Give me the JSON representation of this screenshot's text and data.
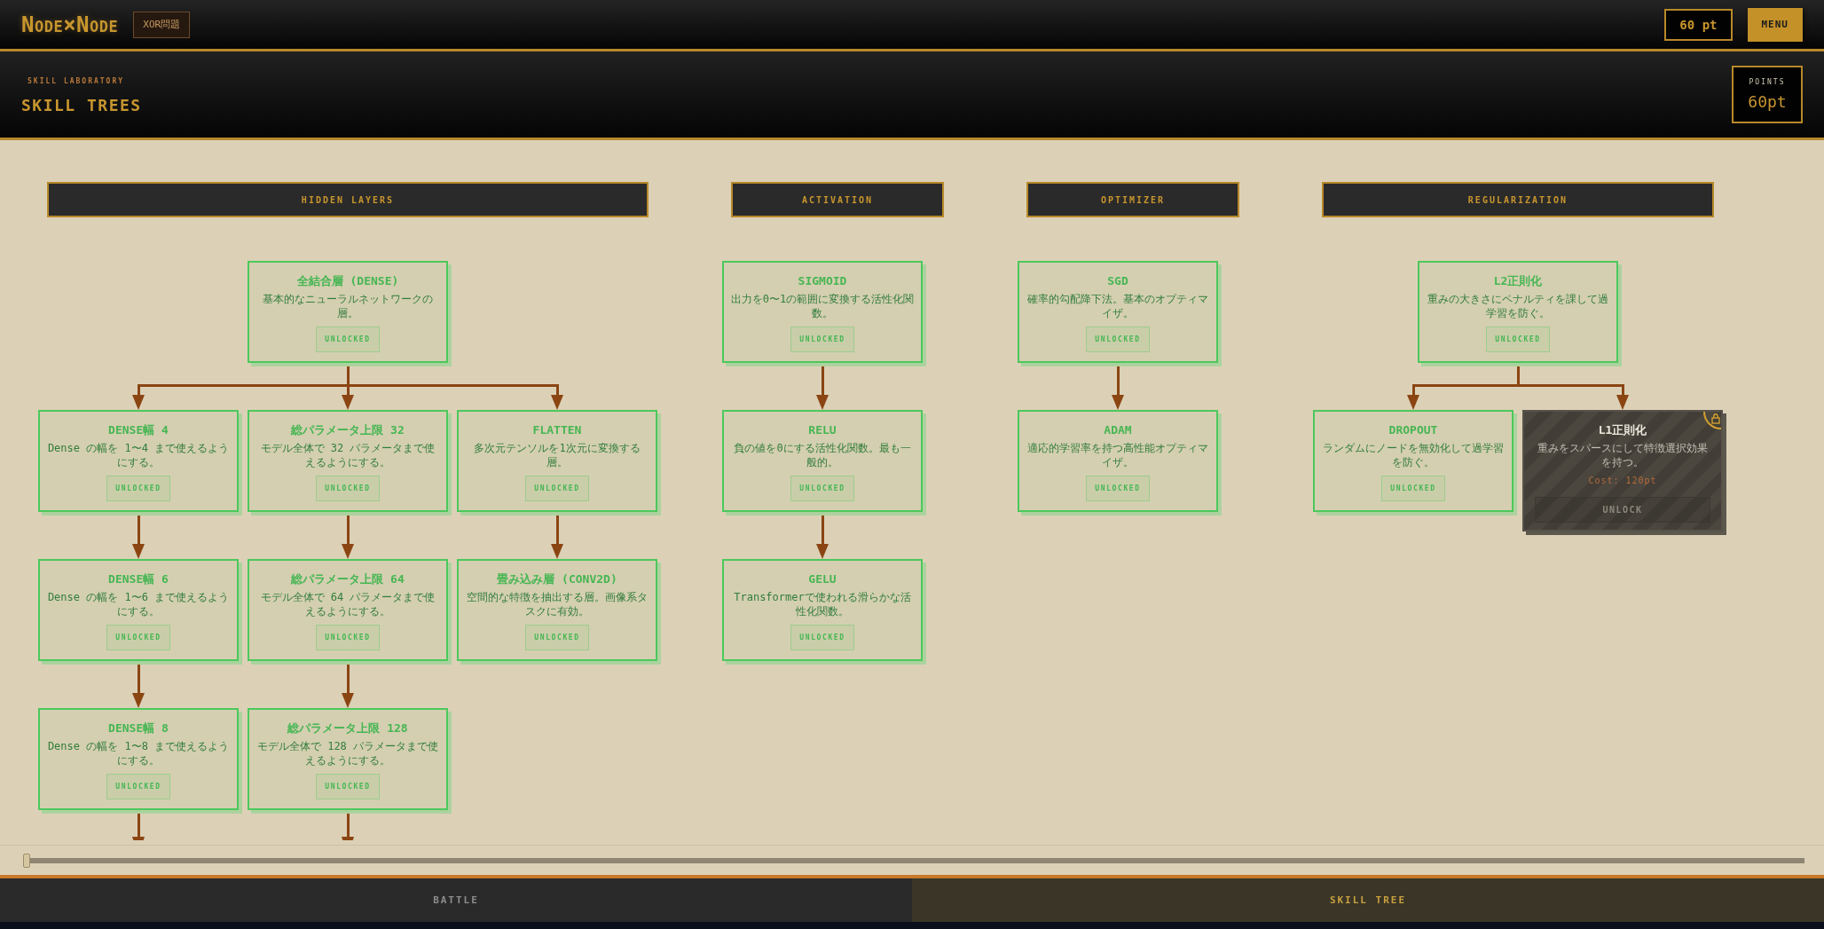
{
  "top_bar": {
    "logo": "Node×Node",
    "problem_badge": "XOR問題",
    "points": "60 pt",
    "menu_button": "MENU"
  },
  "header": {
    "eyebrow": "SKILL LABORATORY",
    "title": "SKILL TREES",
    "points_label": "POINTS",
    "points_value": "60pt"
  },
  "categories": [
    {
      "title": "HIDDEN LAYERS",
      "tree": {
        "kind": "unlocked",
        "title": "全結合層 (DENSE)",
        "description": "基本的なニューラルネットワークの層。",
        "badge": "UNLOCKED",
        "children": [
          {
            "kind": "unlocked",
            "title": "DENSE幅 4",
            "description": "Dense の幅を 1〜4 まで使えるようにする。",
            "badge": "UNLOCKED",
            "children": [
              {
                "kind": "unlocked",
                "title": "DENSE幅 6",
                "description": "Dense の幅を 1〜6 まで使えるようにする。",
                "badge": "UNLOCKED",
                "children": [
                  {
                    "kind": "unlocked",
                    "title": "DENSE幅 8",
                    "description": "Dense の幅を 1〜8 まで使えるようにする。",
                    "badge": "UNLOCKED",
                    "continues": true
                  }
                ]
              }
            ]
          },
          {
            "kind": "unlocked",
            "title": "総パラメータ上限 32",
            "description": "モデル全体で 32 パラメータまで使えるようにする。",
            "badge": "UNLOCKED",
            "children": [
              {
                "kind": "unlocked",
                "title": "総パラメータ上限 64",
                "description": "モデル全体で 64 パラメータまで使えるようにする。",
                "badge": "UNLOCKED",
                "children": [
                  {
                    "kind": "unlocked",
                    "title": "総パラメータ上限 128",
                    "description": "モデル全体で 128 パラメータまで使えるようにする。",
                    "badge": "UNLOCKED",
                    "continues": true
                  }
                ]
              }
            ]
          },
          {
            "kind": "unlocked",
            "title": "FLATTEN",
            "description": "多次元テンソルを1次元に変換する層。",
            "badge": "UNLOCKED",
            "children": [
              {
                "kind": "unlocked",
                "title": "畳み込み層 (CONV2D)",
                "description": "空間的な特徴を抽出する層。画像系タスクに有効。",
                "badge": "UNLOCKED",
                "continues": false
              }
            ]
          }
        ]
      }
    },
    {
      "title": "ACTIVATION",
      "tree": {
        "kind": "unlocked",
        "title": "SIGMOID",
        "description": "出力を0〜1の範囲に変換する活性化関数。",
        "badge": "UNLOCKED",
        "children": [
          {
            "kind": "unlocked",
            "title": "RELU",
            "description": "負の値を0にする活性化関数。最も一般的。",
            "badge": "UNLOCKED",
            "children": [
              {
                "kind": "unlocked",
                "title": "GELU",
                "description": "Transformerで使われる滑らかな活性化関数。",
                "badge": "UNLOCKED",
                "continues": false
              }
            ]
          }
        ]
      }
    },
    {
      "title": "OPTIMIZER",
      "tree": {
        "kind": "unlocked",
        "title": "SGD",
        "description": "確率的勾配降下法。基本のオプティマイザ。",
        "badge": "UNLOCKED",
        "children": [
          {
            "kind": "unlocked",
            "title": "ADAM",
            "description": "適応的学習率を持つ高性能オプティマイザ。",
            "badge": "UNLOCKED",
            "continues": false
          }
        ]
      }
    },
    {
      "title": "REGULARIZATION",
      "tree": {
        "kind": "unlocked",
        "title": "L2正則化",
        "description": "重みの大きさにペナルティを課して過学習を防ぐ。",
        "badge": "UNLOCKED",
        "children": [
          {
            "kind": "unlocked",
            "title": "DROPOUT",
            "description": "ランダムにノードを無効化して過学習を防ぐ。",
            "badge": "UNLOCKED",
            "continues": false
          },
          {
            "kind": "locked",
            "title": "L1正則化",
            "description": "重みをスパースにして特徴選択効果を持つ。",
            "cost": "Cost: 120pt",
            "button": "UNLOCK",
            "continues": false
          }
        ]
      }
    }
  ],
  "bottom_tabs": [
    {
      "label": "BATTLE",
      "selected": false
    },
    {
      "label": "SKILL TREE",
      "selected": true
    }
  ]
}
